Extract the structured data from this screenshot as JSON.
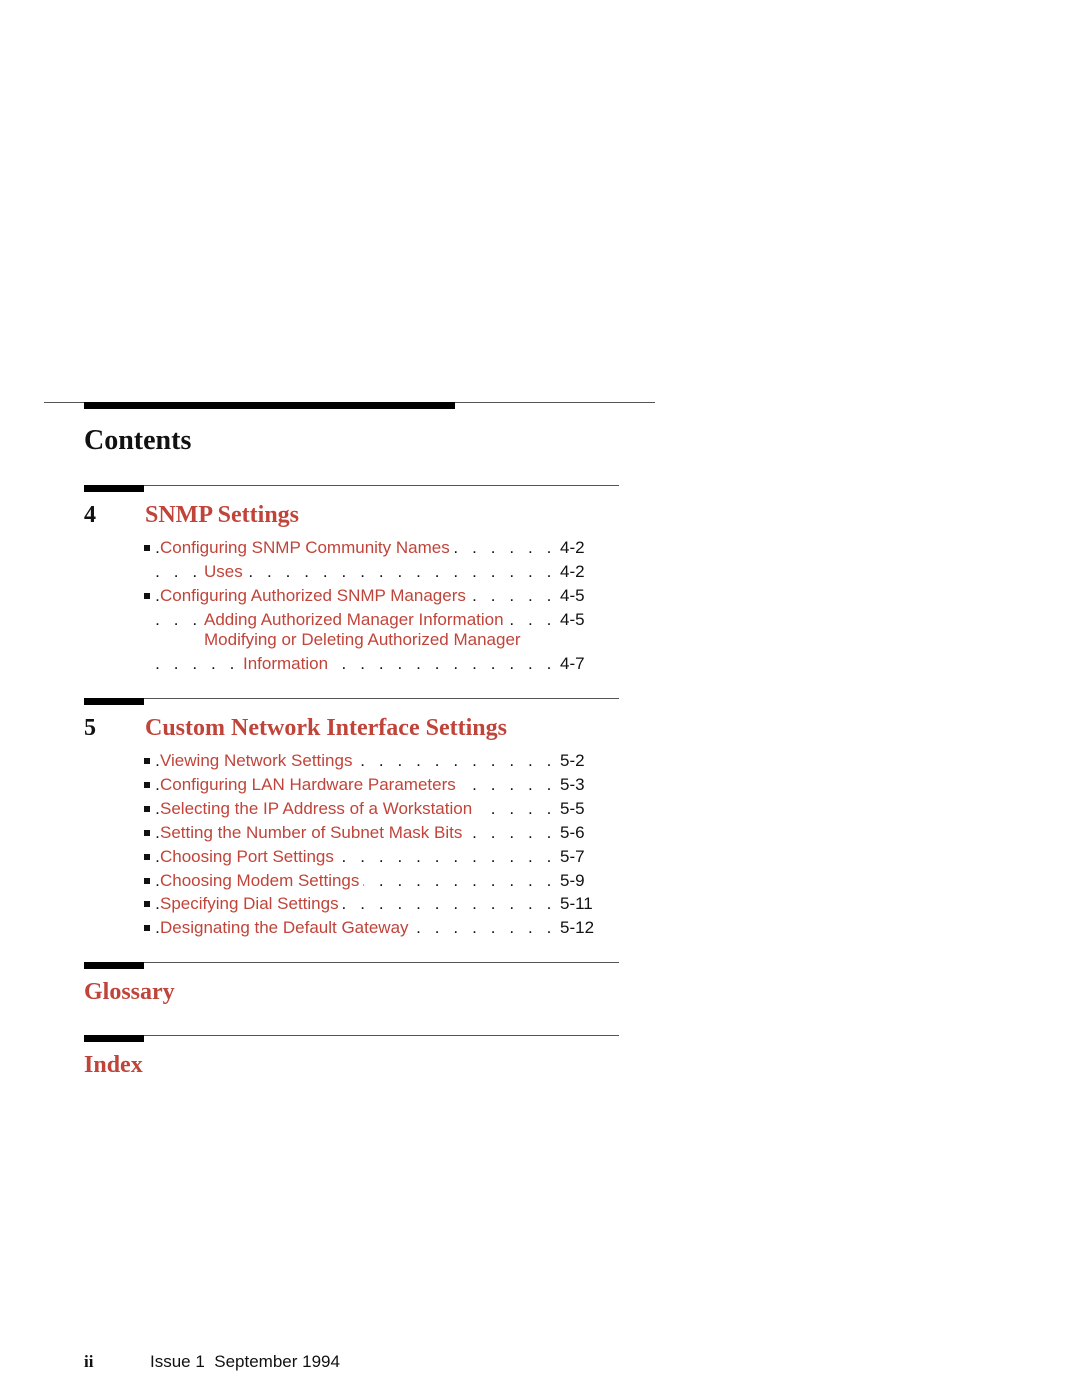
{
  "page": {
    "title": "Contents",
    "colors": {
      "link": "#c0443a",
      "text": "#111111",
      "rule": "#000000"
    }
  },
  "chapters": [
    {
      "number": "4",
      "title": "SNMP Settings",
      "entries": [
        {
          "level": 1,
          "label": "Configuring SNMP Community Names",
          "page": "4-2"
        },
        {
          "level": 2,
          "label": "Uses",
          "page": "4-2"
        },
        {
          "level": 1,
          "label": "Configuring Authorized SNMP Managers",
          "page": "4-5"
        },
        {
          "level": 2,
          "label": "Adding Authorized Manager Information",
          "page": "4-5"
        },
        {
          "level": 2,
          "label_line1": "Modifying or Deleting Authorized Manager",
          "label": "Information",
          "page": "4-7"
        }
      ]
    },
    {
      "number": "5",
      "title": "Custom Network Interface Settings",
      "entries": [
        {
          "level": 1,
          "label": "Viewing Network Settings",
          "page": "5-2"
        },
        {
          "level": 1,
          "label": "Configuring LAN Hardware Parameters",
          "page": "5-3"
        },
        {
          "level": 1,
          "label": "Selecting the IP Address of a Workstation",
          "page": "5-5"
        },
        {
          "level": 1,
          "label": "Setting the Number of Subnet Mask Bits",
          "page": "5-6"
        },
        {
          "level": 1,
          "label": "Choosing Port Settings",
          "page": "5-7"
        },
        {
          "level": 1,
          "label": "Choosing Modem Settings",
          "page": "5-9"
        },
        {
          "level": 1,
          "label": "Specifying Dial Settings",
          "page": "5-11"
        },
        {
          "level": 1,
          "label": "Designating the Default Gateway",
          "page": "5-12"
        }
      ]
    }
  ],
  "glossary": {
    "title": "Glossary"
  },
  "index": {
    "title": "Index"
  },
  "footer": {
    "page_number": "ii",
    "issue": "Issue 1  September 1994"
  },
  "leader_dots": ". . . . . . . . . . . . . . . . . . . . . . . . . . . . . . . . . . . . . . . . . . . . . . . . . ."
}
